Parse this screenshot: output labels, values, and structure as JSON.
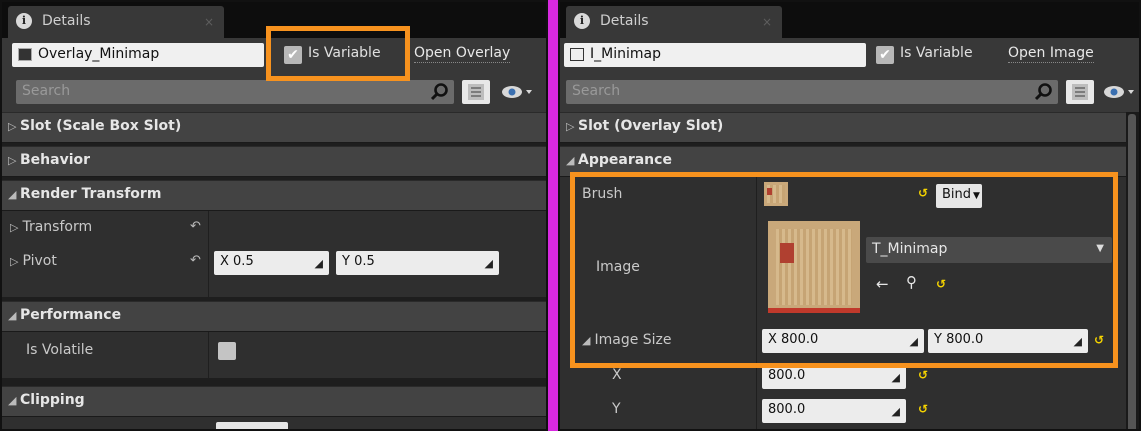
{
  "left": {
    "tab": {
      "icon": "i",
      "title": "Details",
      "close": "×"
    },
    "name": "Overlay_Minimap",
    "is_variable": {
      "label": "Is Variable",
      "checked": "✔"
    },
    "open_link": "Open Overlay",
    "search_placeholder": "Search",
    "categories": {
      "slot": "Slot (Scale Box Slot)",
      "behavior": "Behavior",
      "render_transform": "Render Transform",
      "performance": "Performance",
      "clipping": "Clipping"
    },
    "props": {
      "transform": "Transform",
      "pivot": "Pivot",
      "pivot_x": "X  0.5",
      "pivot_y": "Y  0.5",
      "is_volatile": "Is Volatile"
    }
  },
  "right": {
    "tab": {
      "icon": "i",
      "title": "Details",
      "close": "×"
    },
    "name": "I_Minimap",
    "is_variable": {
      "label": "Is Variable",
      "checked": "✔"
    },
    "open_link": "Open Image",
    "search_placeholder": "Search",
    "categories": {
      "slot": "Slot (Overlay Slot)",
      "appearance": "Appearance"
    },
    "props": {
      "brush": "Brush",
      "bind": "Bind",
      "image": "Image",
      "image_asset": "T_Minimap",
      "image_size": "Image Size",
      "size_x": "X  800.0",
      "size_y": "Y  800.0",
      "x": "X",
      "y": "Y",
      "x_value": "800.0",
      "y_value": "800.0"
    }
  },
  "icons": {
    "arrow_right": "▷",
    "arrow_down": "◢",
    "reset": "↶",
    "yellow_reset": "↺",
    "drag": "◢",
    "combo_arrow": "▼",
    "back": "←",
    "browse": "⚲"
  },
  "colors": {
    "highlight": "#f7921e",
    "divider": "#d829e0",
    "reset_yellow": "#f5d300"
  }
}
